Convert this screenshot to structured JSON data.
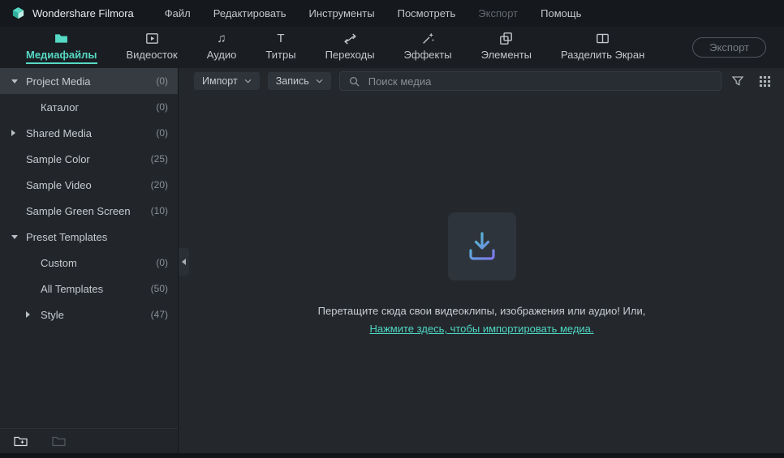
{
  "app": {
    "title": "Wondershare Filmora"
  },
  "menubar": {
    "items": [
      {
        "label": "Файл",
        "enabled": true
      },
      {
        "label": "Редактировать",
        "enabled": true
      },
      {
        "label": "Инструменты",
        "enabled": true
      },
      {
        "label": "Посмотреть",
        "enabled": true
      },
      {
        "label": "Экспорт",
        "enabled": false
      },
      {
        "label": "Помощь",
        "enabled": true
      }
    ]
  },
  "tabbar": {
    "tabs": [
      {
        "label": "Медиафайлы",
        "icon": "media-files-icon",
        "active": true
      },
      {
        "label": "Видеосток",
        "icon": "video-stock-icon",
        "active": false
      },
      {
        "label": "Аудио",
        "icon": "audio-icon",
        "active": false
      },
      {
        "label": "Титры",
        "icon": "titles-icon",
        "active": false
      },
      {
        "label": "Переходы",
        "icon": "transitions-icon",
        "active": false
      },
      {
        "label": "Эффекты",
        "icon": "effects-icon",
        "active": false
      },
      {
        "label": "Элементы",
        "icon": "elements-icon",
        "active": false
      },
      {
        "label": "Разделить Экран",
        "icon": "split-screen-icon",
        "active": false
      }
    ],
    "export_button": "Экспорт"
  },
  "sidebar": {
    "items": [
      {
        "label": "Project Media",
        "count": "(0)",
        "arrow": "down",
        "level": 0,
        "selected": true
      },
      {
        "label": "Каталог",
        "count": "(0)",
        "arrow": "none",
        "level": 1,
        "selected": false
      },
      {
        "label": "Shared Media",
        "count": "(0)",
        "arrow": "right",
        "level": 0,
        "selected": false
      },
      {
        "label": "Sample Color",
        "count": "(25)",
        "arrow": "none",
        "level": 0,
        "selected": false
      },
      {
        "label": "Sample Video",
        "count": "(20)",
        "arrow": "none",
        "level": 0,
        "selected": false
      },
      {
        "label": "Sample Green Screen",
        "count": "(10)",
        "arrow": "none",
        "level": 0,
        "selected": false
      },
      {
        "label": "Preset Templates",
        "count": "",
        "arrow": "down",
        "level": 0,
        "selected": false
      },
      {
        "label": "Custom",
        "count": "(0)",
        "arrow": "none",
        "level": 1,
        "selected": false
      },
      {
        "label": "All Templates",
        "count": "(50)",
        "arrow": "none",
        "level": 1,
        "selected": false
      },
      {
        "label": "Style",
        "count": "(47)",
        "arrow": "right",
        "level": 1,
        "selected": false
      }
    ]
  },
  "toolbar": {
    "import_label": "Импорт",
    "record_label": "Запись",
    "search_placeholder": "Поиск медиа"
  },
  "dropzone": {
    "message": "Перетащите сюда свои видеоклипы, изображения или аудио! Или,",
    "link": "Нажмите здесь, чтобы импортировать медиа."
  },
  "colors": {
    "accent": "#56d9c4",
    "link": "#4fd6c3"
  }
}
